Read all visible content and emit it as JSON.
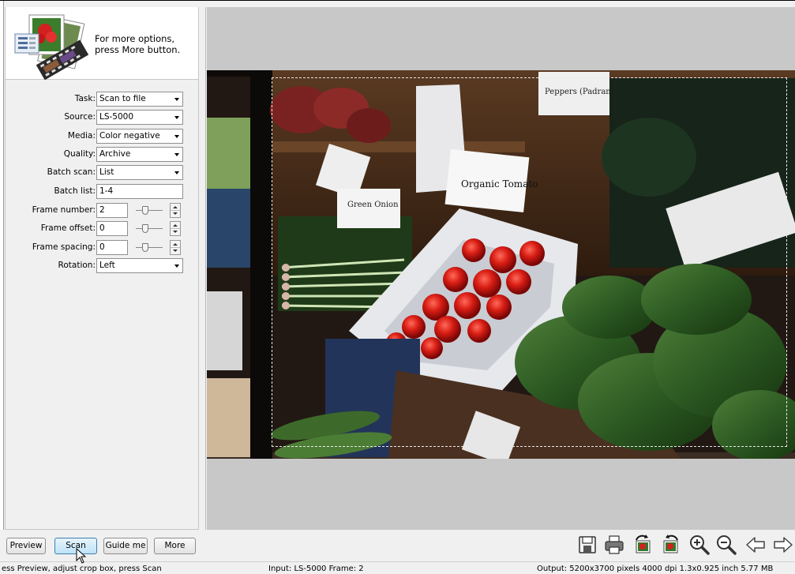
{
  "hint": {
    "line1": "For more options,",
    "line2": "press More button."
  },
  "settings": {
    "task": {
      "label": "Task:",
      "value": "Scan to file"
    },
    "source": {
      "label": "Source:",
      "value": "LS-5000"
    },
    "media": {
      "label": "Media:",
      "value": "Color negative"
    },
    "quality": {
      "label": "Quality:",
      "value": "Archive"
    },
    "batch_scan": {
      "label": "Batch scan:",
      "value": "List"
    },
    "batch_list": {
      "label": "Batch list:",
      "value": "1-4"
    },
    "frame_number": {
      "label": "Frame number:",
      "value": "2"
    },
    "frame_offset": {
      "label": "Frame offset:",
      "value": "0"
    },
    "frame_spacing": {
      "label": "Frame spacing:",
      "value": "0"
    },
    "rotation": {
      "label": "Rotation:",
      "value": "Left"
    }
  },
  "buttons": {
    "preview": "Preview",
    "scan": "Scan",
    "guide_me": "Guide me",
    "more": "More"
  },
  "toolbar_icons": [
    "save-icon",
    "print-icon",
    "rotate-left-icon",
    "rotate-right-icon",
    "zoom-in-icon",
    "zoom-out-icon",
    "arrow-left-icon",
    "arrow-right-icon"
  ],
  "status": {
    "hint": "ess Preview, adjust crop box, press Scan",
    "input": "Input: LS-5000 Frame: 2",
    "output": "Output: 5200x3700 pixels 4000 dpi 1.3x0.925 inch 5.77 MB"
  },
  "photo_signs": {
    "organic_tomato": "Organic Tomato",
    "green_onion": "Green Onion",
    "peppers": "Peppers (Padrano)"
  }
}
